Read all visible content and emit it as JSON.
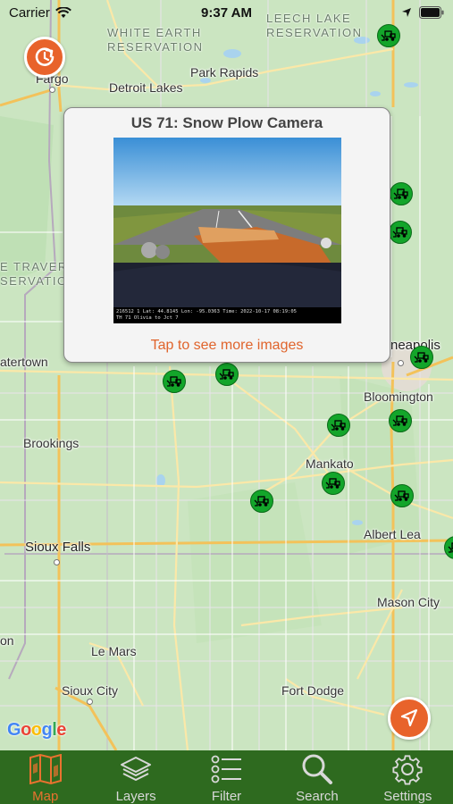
{
  "status_bar": {
    "carrier": "Carrier",
    "time": "9:37 AM"
  },
  "map": {
    "cities": [
      {
        "name": "Fargo"
      },
      {
        "name": "Detroit Lakes"
      },
      {
        "name": "Park Rapids"
      },
      {
        "name": "Watertown",
        "display": "atertown"
      },
      {
        "name": "Brookings"
      },
      {
        "name": "Sioux Falls"
      },
      {
        "name": "Le Mars"
      },
      {
        "name": "Sioux City"
      },
      {
        "name": "Fort Dodge"
      },
      {
        "name": "Mason City"
      },
      {
        "name": "Albert Lea"
      },
      {
        "name": "Mankato"
      },
      {
        "name": "Bloomington"
      },
      {
        "name": "Minneapolis",
        "display": "neapolis"
      },
      {
        "name": "Vermillion",
        "display": "on"
      }
    ],
    "reservations": [
      {
        "line1": "WHITE EARTH",
        "line2": "RESERVATION"
      },
      {
        "line1": "LEECH LAKE",
        "line2": "RESERVATION"
      },
      {
        "line1": "E TRAVER",
        "line2": "SERVATIO"
      }
    ],
    "marker_icon": "snow-plow-icon",
    "marker_color": "#13a52a",
    "attribution": "Google"
  },
  "popup": {
    "title": "US 71: Snow Plow Camera",
    "image_caption_line1": "216512 1 Lat: 44.8145 Lon: -95.0363 Time: 2022-10-17 08:19:05",
    "image_caption_line2": "TH 71 Olivia to Jct 7",
    "link": "Tap to see more images"
  },
  "buttons": {
    "refresh_icon": "refresh-icon",
    "locate_icon": "location-arrow-icon",
    "accent_color": "#e8632b"
  },
  "tabs": [
    {
      "label": "Map",
      "icon": "map-icon",
      "active": true
    },
    {
      "label": "Layers",
      "icon": "layers-icon",
      "active": false
    },
    {
      "label": "Filter",
      "icon": "filter-list-icon",
      "active": false
    },
    {
      "label": "Search",
      "icon": "search-icon",
      "active": false
    },
    {
      "label": "Settings",
      "icon": "gear-icon",
      "active": false
    }
  ],
  "colors": {
    "tab_bar": "#2e6a1f",
    "tab_active": "#e8722f",
    "tab_inactive": "#d8d8d8"
  }
}
